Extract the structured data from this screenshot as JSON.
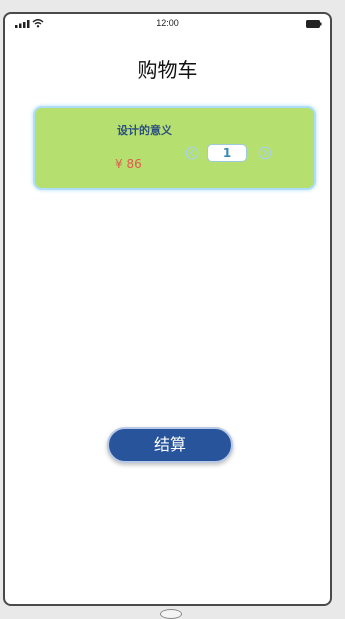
{
  "status_bar": {
    "time": "12:00",
    "icons": [
      "signal-icon",
      "wifi-icon",
      "battery-icon"
    ]
  },
  "header": {
    "title": "购物车"
  },
  "cart": {
    "items": [
      {
        "name": "设计的意义",
        "price": "¥ 86",
        "quantity": "1",
        "icons": [
          "minus-circle-icon",
          "plus-circle-icon"
        ]
      }
    ]
  },
  "footer": {
    "checkout_label": "结算"
  },
  "colors": {
    "card_background": "#b5df6e",
    "card_border": "#aeddf7",
    "item_name": "#2c4f82",
    "price": "#e35a4f",
    "quantity": "#3a88b8",
    "checkout_button": "#27549a"
  }
}
